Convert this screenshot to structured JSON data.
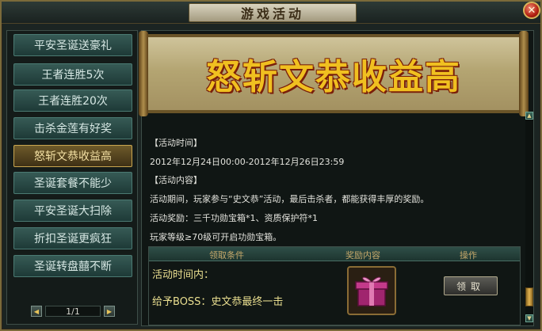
{
  "window": {
    "title": "游戏活动",
    "close_label": "✕"
  },
  "sidebar": {
    "items": [
      {
        "label": "平安圣诞送豪礼",
        "active": false
      },
      {
        "label": "王者连胜5次",
        "active": false
      },
      {
        "label": "王者连胜20次",
        "active": false
      },
      {
        "label": "击杀金莲有好奖",
        "active": false
      },
      {
        "label": "怒斩文恭收益高",
        "active": true
      },
      {
        "label": "圣诞套餐不能少",
        "active": false
      },
      {
        "label": "平安圣诞大扫除",
        "active": false
      },
      {
        "label": "折扣圣诞更疯狂",
        "active": false
      },
      {
        "label": "圣诞转盘囍不断",
        "active": false
      }
    ],
    "pager": {
      "prev_icon": "◀",
      "next_icon": "▶",
      "page_text": "1/1"
    }
  },
  "main": {
    "banner_title": "怒斩文恭收益高",
    "time_heading": "【活动时间】",
    "time_value": "2012年12月24日00:00-2012年12月26日23:59",
    "content_heading": "【活动内容】",
    "content_line1": "活动期间，玩家参与“史文恭”活动，最后击杀者，都能获得丰厚的奖励。",
    "content_line2": "活动奖励：三千功勋宝箱*1、资质保护符*1",
    "content_line3": "玩家等级≥70级可开启功勋宝箱。",
    "table": {
      "headers": [
        "领取条件",
        "奖励内容",
        "操作"
      ],
      "row": {
        "condition_line1": "活动时间内：",
        "condition_line2": "给予BOSS：史文恭最终一击",
        "reward_icon": "gift-box-icon",
        "action_label": "领取"
      }
    },
    "scrollbar": {
      "up_icon": "▲",
      "down_icon": "▼"
    }
  },
  "colors": {
    "banner_text": "#f0c020",
    "active_tab": "#6e5a2a",
    "tab": "#365a55"
  }
}
